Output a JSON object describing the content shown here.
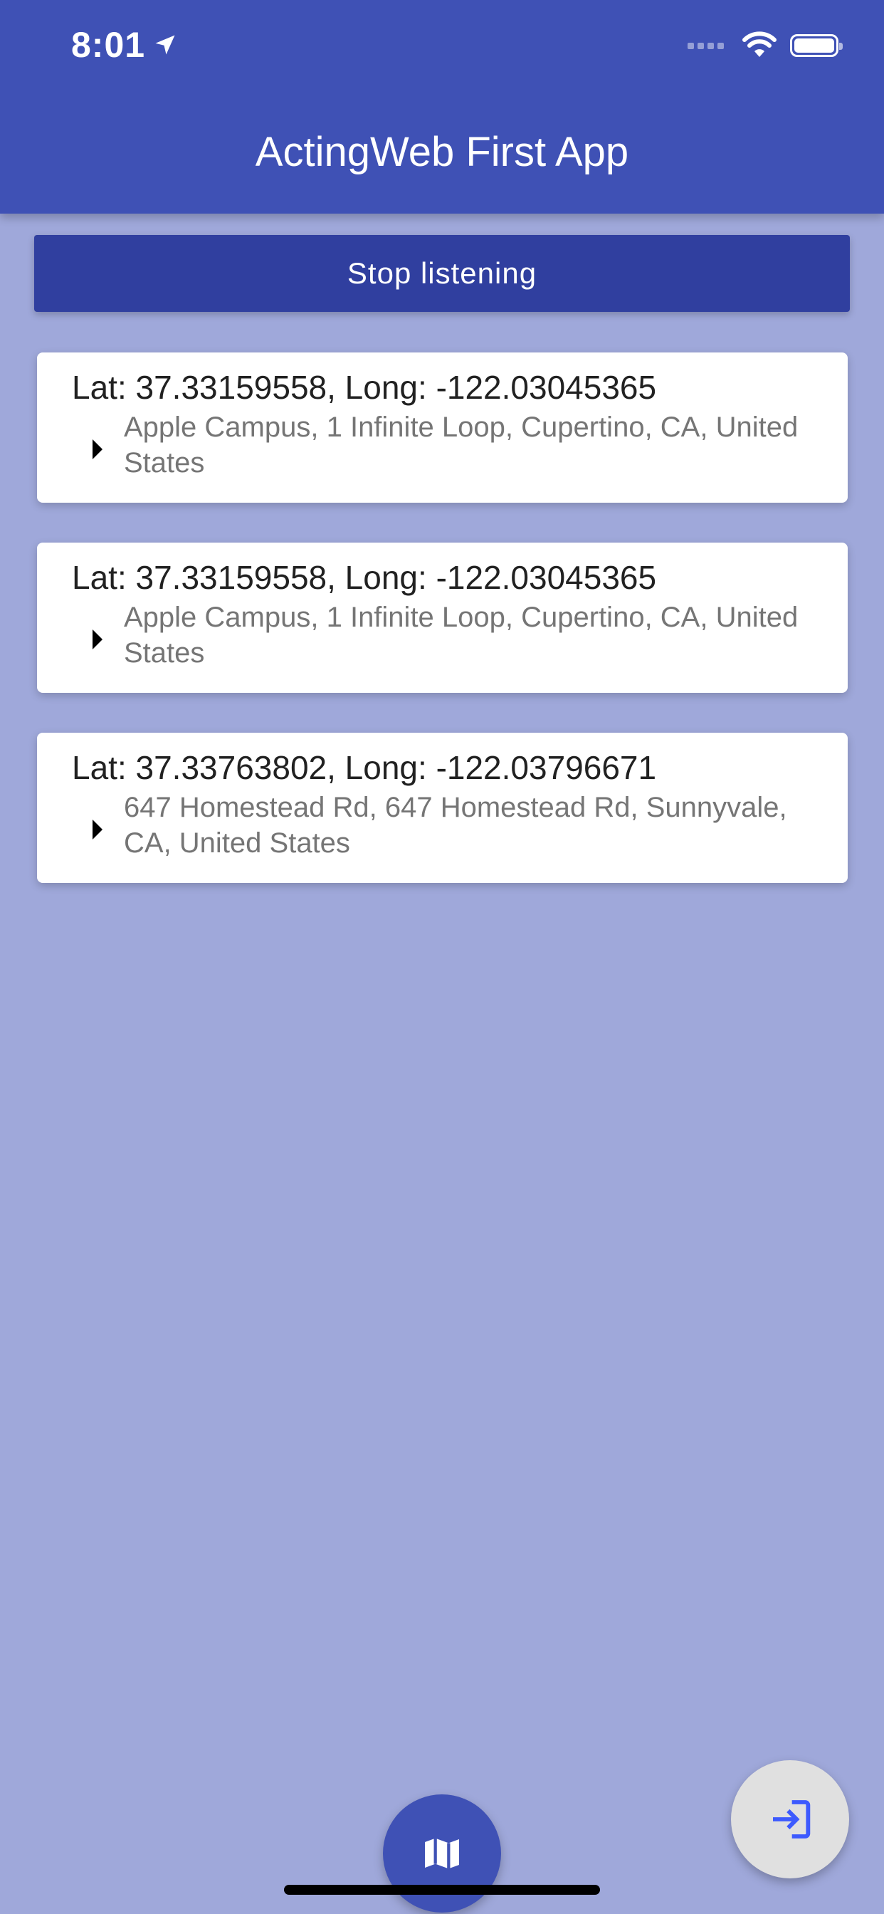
{
  "status_bar": {
    "time": "8:01",
    "location_icon": "location-arrow-icon",
    "signal_icon": "cellular-signal-icon",
    "wifi_icon": "wifi-icon",
    "battery_icon": "battery-icon",
    "battery_level": 1.0
  },
  "app_bar": {
    "title": "ActingWeb First App"
  },
  "main": {
    "stop_button_label": "Stop listening",
    "locations": [
      {
        "title": "Lat: 37.33159558, Long: -122.03045365",
        "address": "Apple Campus, 1 Infinite Loop, Cupertino, CA, United States"
      },
      {
        "title": "Lat: 37.33159558, Long: -122.03045365",
        "address": "Apple Campus, 1 Infinite Loop, Cupertino, CA, United States"
      },
      {
        "title": "Lat: 37.33763802, Long: -122.03796671",
        "address": "647 Homestead Rd, 647 Homestead Rd, Sunnyvale, CA, United States"
      }
    ]
  },
  "fabs": {
    "map_icon": "map-icon",
    "exit_icon": "exit-to-app-icon"
  },
  "colors": {
    "primary": "#3f51b5",
    "primary_dark": "#303f9f",
    "background": "#9fa8da",
    "fab_exit_background": "#e0e0e0",
    "exit_icon": "#3d5afe"
  }
}
